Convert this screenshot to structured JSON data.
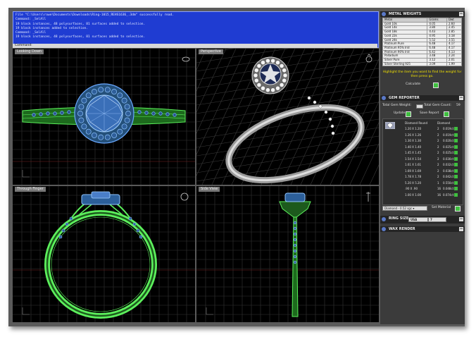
{
  "command": {
    "lines": [
      "File \"C:\\Users\\rowe\\Documents\\Downloads\\Ring-1015_REHS1636_.3dm\" successfully read.",
      "Command: _SelAll",
      "19 block instances, 48 polysurfaces, 81 surfaces added to selection.",
      "19 block instances added to selection.",
      "Command: _SelAll",
      "19 block instances, 48 polysurfaces, 81 surfaces added to selection."
    ],
    "prompt": "Command:"
  },
  "viewports": {
    "top": "Looking Down",
    "perspective": "Perspective",
    "front": "Through Finger",
    "side": "Side View"
  },
  "metal_weights": {
    "title": "METAL WEIGHTS",
    "headers": [
      "Metal",
      "Grams",
      "Dwt"
    ],
    "rows": [
      [
        "Gold 10k",
        "4.05",
        "2.60"
      ],
      [
        "Gold 14k",
        "3.80",
        "2.45"
      ],
      [
        "Gold 18k",
        "4.43",
        "2.85"
      ],
      [
        "Gold 22k",
        "4.95",
        "3.18"
      ],
      [
        "Gold 24k",
        "5.52",
        "3.55"
      ],
      [
        "Platinum Pure",
        "6.48",
        "4.17"
      ],
      [
        "Platinum 95% Irid",
        "6.48",
        "4.17"
      ],
      [
        "Platinum 90% Irid",
        "6.42",
        "4.13"
      ],
      [
        "Palladium",
        "3.48",
        "2.24"
      ],
      [
        "Silver Pure",
        "3.12",
        "2.01"
      ],
      [
        "Silver Sterling 925",
        "3.09",
        "1.99"
      ]
    ],
    "hint": "Highlight the item you want to find the weight for then press go.",
    "calculate": "Calculate"
  },
  "gem_reporter": {
    "title": "GEM REPORTER",
    "total_weight_label": "Total Gem Weight:",
    "total_count_label": "Total Gem Count:",
    "total_count": "59",
    "update": "Update",
    "save_report": "Save Report",
    "col_shape": "Diamond Round",
    "col_material": "Diamond",
    "rows": [
      [
        "1.20 X 1.20",
        "2",
        "0.019ct"
      ],
      [
        "1.26 X 1.26",
        "2",
        "0.019ct"
      ],
      [
        "1.30 X 1.30",
        "2",
        "0.020ct"
      ],
      [
        "1.40 X 1.40",
        "2",
        "0.025ct"
      ],
      [
        "1.45 X 1.45",
        "2",
        "0.025ct"
      ],
      [
        "1.54 X 1.54",
        "2",
        "0.030ct"
      ],
      [
        "1.61 X 1.61",
        "2",
        "0.032ct"
      ],
      [
        "1.69 X 1.69",
        "2",
        "0.038ct"
      ],
      [
        "1.78 X 1.78",
        "2",
        "0.042ct"
      ],
      [
        "5.20 X 5.20",
        "1",
        "0.550ct"
      ],
      [
        ".90 X .90",
        "16",
        "0.048ct"
      ],
      [
        "1.00 X 1.00",
        "16",
        "0.074ct"
      ]
    ],
    "material_select": "Diamond - 0.52 sgc",
    "set_material": "Set Material"
  },
  "ring_size": {
    "title": "RING SIZE",
    "system": "USA",
    "size": "7"
  },
  "wax_render": {
    "title": "WAX RENDER"
  },
  "colors": {
    "command_bg": "#1f3cd2",
    "wire_green": "#5cf05c",
    "wire_blue": "#6aa8ff",
    "grid": "#3a3a3a",
    "hint_yellow": "#f0e000"
  }
}
